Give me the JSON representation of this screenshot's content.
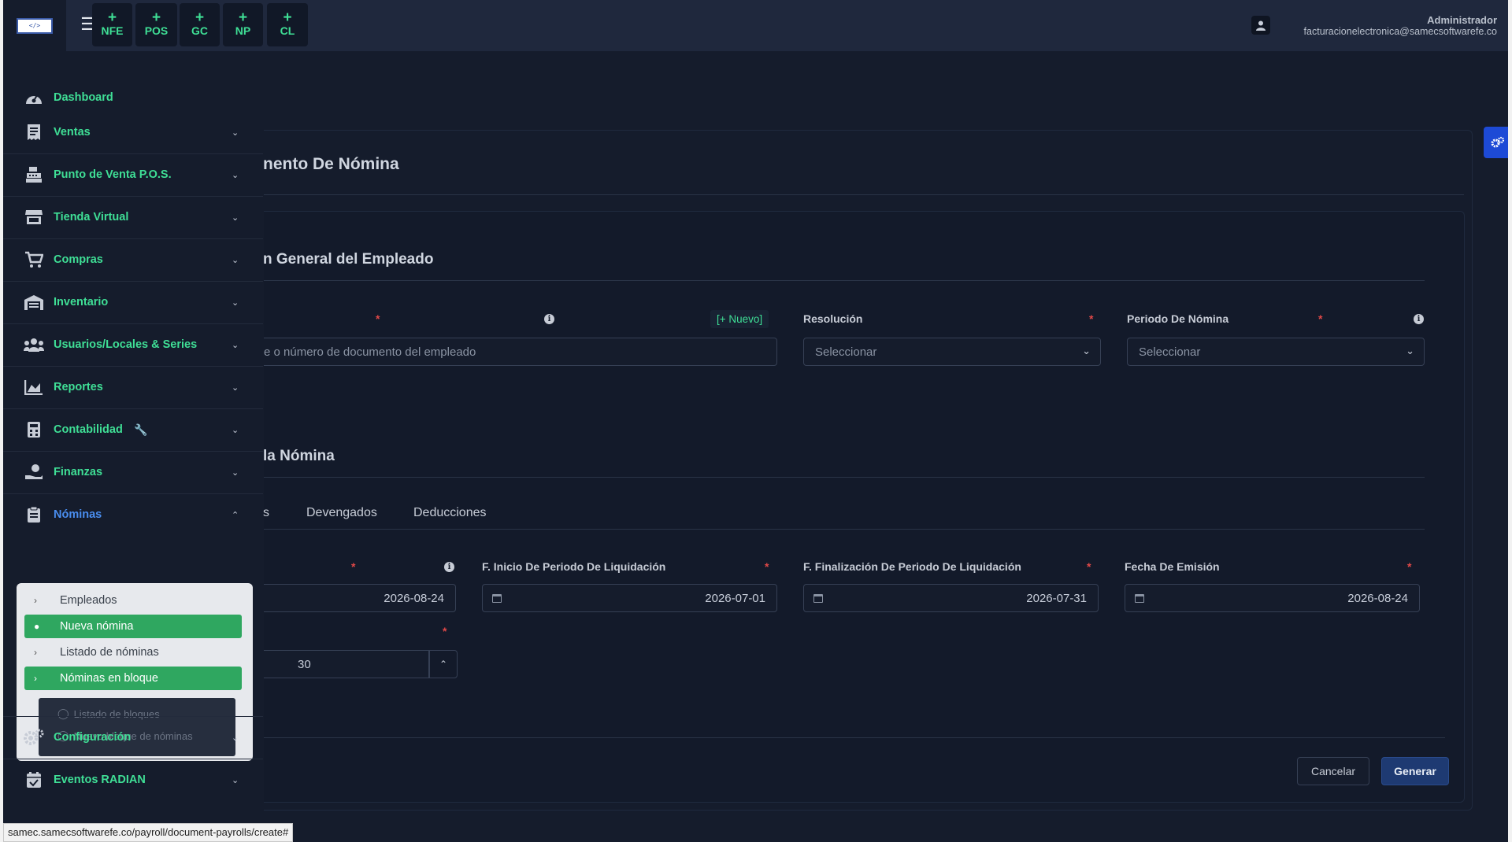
{
  "header": {
    "logo_text": "</>",
    "quick_buttons": [
      {
        "plus": "+",
        "label": "NFE"
      },
      {
        "plus": "+",
        "label": "POS"
      },
      {
        "plus": "+",
        "label": "GC"
      },
      {
        "plus": "+",
        "label": "NP"
      },
      {
        "plus": "+",
        "label": "CL"
      }
    ],
    "user_name": "Administrador",
    "user_email": "facturacionelectronica@samecsoftwarefe.co"
  },
  "sidebar": {
    "items": [
      {
        "label": "Dashboard",
        "icon": "gauge-icon"
      },
      {
        "label": "Ventas",
        "icon": "receipt-icon"
      },
      {
        "label": "Punto de Venta P.O.S.",
        "icon": "cash-register-icon"
      },
      {
        "label": "Tienda Virtual",
        "icon": "store-icon"
      },
      {
        "label": "Compras",
        "icon": "cart-icon"
      },
      {
        "label": "Inventario",
        "icon": "warehouse-icon"
      },
      {
        "label": "Usuarios/Locales & Series",
        "icon": "users-icon"
      },
      {
        "label": "Reportes",
        "icon": "area-chart-icon"
      },
      {
        "label": "Contabilidad",
        "icon": "calculator-icon"
      },
      {
        "label": "Finanzas",
        "icon": "hand-money-icon"
      },
      {
        "label": "Nóminas",
        "icon": "clipboard-icon"
      },
      {
        "label": "Configuración",
        "icon": "gears-icon"
      },
      {
        "label": "Eventos RADIAN",
        "icon": "calendar-check-icon"
      }
    ],
    "nominas_submenu": [
      {
        "label": "Empleados",
        "active": false
      },
      {
        "label": "Nueva nómina",
        "active": true
      },
      {
        "label": "Listado de nóminas",
        "active": false
      },
      {
        "label": "Nóminas en bloque",
        "active": true
      }
    ],
    "bloque_submenu": [
      {
        "label": "Listado de bloques"
      },
      {
        "label": "Nuevo bloque de nóminas"
      }
    ],
    "colors": {
      "accent": "#3fdf96",
      "active_bg": "#2fa760",
      "active_label": "#4a8ef0"
    }
  },
  "main": {
    "page_title": "nento De Nómina",
    "section1_title": "n General del Empleado",
    "employee": {
      "required": "*",
      "new_link": "[+ Nuevo]",
      "placeholder": "e o número de documento del empleado"
    },
    "resolucion": {
      "label": "Resolución",
      "required": "*",
      "value": "Seleccionar"
    },
    "periodo": {
      "label": "Periodo De Nómina",
      "required": "*",
      "value": "Seleccionar"
    },
    "section2_title": "la Nómina",
    "tabs": [
      {
        "label": "s"
      },
      {
        "label": "Devengados"
      },
      {
        "label": "Deducciones"
      }
    ],
    "date_fields": [
      {
        "label": "",
        "required": "*",
        "value": "2026-08-24"
      },
      {
        "label": "F. Inicio De Periodo De Liquidación",
        "required": "*",
        "value": "2026-07-01"
      },
      {
        "label": "F. Finalización De Periodo De Liquidación",
        "required": "*",
        "value": "2026-07-31"
      },
      {
        "label": "Fecha De Emisión",
        "required": "*",
        "value": "2026-08-24"
      }
    ],
    "days": {
      "required": "*",
      "value": "30"
    },
    "buttons": {
      "cancel": "Cancelar",
      "generate": "Generar"
    }
  },
  "status_bar": {
    "url": "samec.samecsoftwarefe.co/payroll/document-payrolls/create#"
  }
}
